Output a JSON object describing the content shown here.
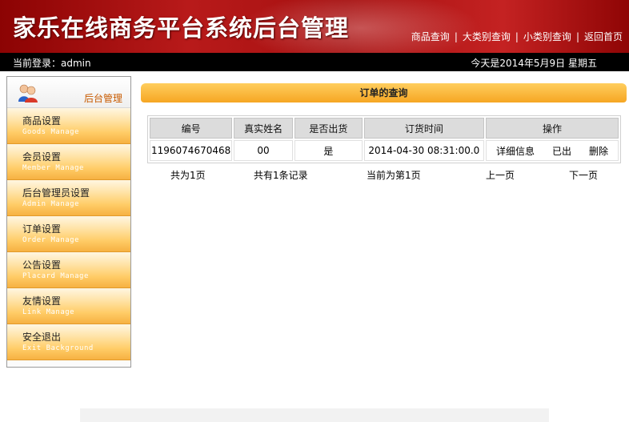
{
  "header": {
    "site_title": "家乐在线商务平台系统后台管理",
    "nav": [
      "商品查询",
      "大类别查询",
      "小类别查询",
      "返回首页"
    ],
    "nav_separator": "|"
  },
  "status": {
    "login": "当前登录：admin",
    "date": "今天是2014年5月9日 星期五"
  },
  "sidebar": {
    "title": "后台管理",
    "avatar_icon": "users-icon",
    "items": [
      {
        "label": "商品设置",
        "sub": "Goods Manage"
      },
      {
        "label": "会员设置",
        "sub": "Member Manage"
      },
      {
        "label": "后台管理员设置",
        "sub": "Admin Manage"
      },
      {
        "label": "订单设置",
        "sub": "Order Manage"
      },
      {
        "label": "公告设置",
        "sub": "Placard Manage"
      },
      {
        "label": "友情设置",
        "sub": "Link Manage"
      },
      {
        "label": "安全退出",
        "sub": "Exit Background"
      }
    ]
  },
  "main": {
    "section_title": "订单的查询",
    "table": {
      "columns": [
        "编号",
        "真实姓名",
        "是否出货",
        "订货时间",
        "操作"
      ],
      "rows": [
        {
          "id": "1196074670468",
          "name": "00",
          "shipped": "是",
          "time": "2014-04-30 08:31:00.0",
          "actions": [
            "详细信息",
            "已出",
            "删除"
          ]
        }
      ]
    },
    "pager": {
      "total_pages": "共为1页",
      "total_records": "共有1条记录",
      "current": "当前为第1页",
      "prev": "上一页",
      "next": "下一页"
    }
  },
  "colors": {
    "banner_red": "#a51010",
    "menu_orange": "#ffcc66",
    "section_bar": "#f6a623"
  }
}
